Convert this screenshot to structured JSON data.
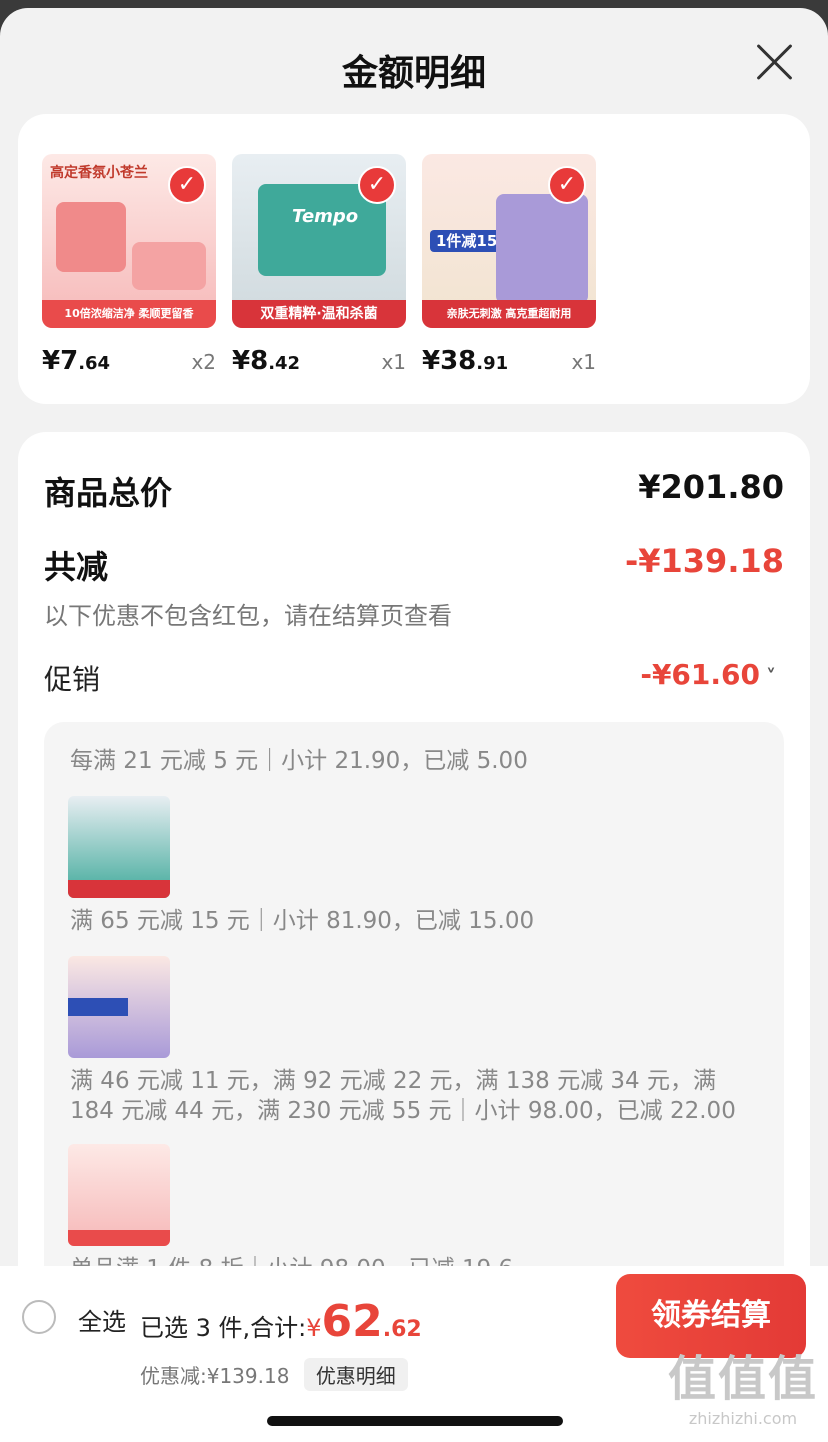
{
  "sheet": {
    "title": "金额明细"
  },
  "products": [
    {
      "headline": "高定香氛小苍兰",
      "tag": "10倍浓缩洁净 柔顺更留香",
      "price_int": "¥7",
      "price_dec": ".64",
      "qty": "x2",
      "color": "#f6b8b8"
    },
    {
      "headline": "Tempo",
      "tag": "双重精粹·温和杀菌",
      "price_int": "¥8",
      "price_dec": ".42",
      "qty": "x1",
      "color": "#3fa99a"
    },
    {
      "headline": "1件减15",
      "tag": "亲肤无刺激 高克重超耐用",
      "price_int": "¥38",
      "price_dec": ".91",
      "qty": "x1",
      "color": "#f1e4d0"
    }
  ],
  "summary": {
    "total_label": "商品总价",
    "total_value": "¥201.80",
    "reduce_label": "共减",
    "reduce_value": "-¥139.18",
    "note": "以下优惠不包含红包，请在结算页查看",
    "promo_label": "促销",
    "promo_value": "-¥61.60",
    "promo_chevron": "˅"
  },
  "promo_lines": [
    "每满 21 元减 5 元｜小计 21.90，已减 5.00",
    "满 65 元减 15 元｜小计 81.90，已减 15.00",
    "满 46 元减 11 元，满 92 元减 22 元，满 138 元减 34 元，满 184 元减 44 元，满 230 元减 55 元｜小计 98.00，已减 22.00",
    "单品满 1 件 8 折｜小计 98.00，已减 19.6"
  ],
  "bottom": {
    "select_all": "全选",
    "selected_prefix": "已选 3 件,合计:",
    "total_symbol": "¥",
    "total_int": "62",
    "total_dec": ".62",
    "discount_text": "优惠减:¥139.18",
    "detail_button": "优惠明细",
    "checkout_button": "领券结算"
  },
  "watermark": {
    "big": "值值值",
    "small": "zhizhizhi.com"
  },
  "colors": {
    "accent_red": "#e8453a",
    "check_red": "#e83a3a"
  }
}
